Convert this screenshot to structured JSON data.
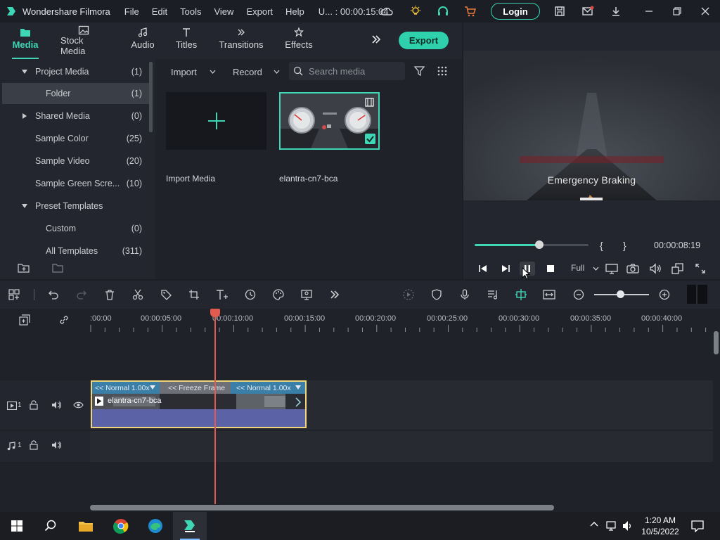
{
  "titlebar": {
    "app_name": "Wondershare Filmora",
    "menu": [
      "File",
      "Edit",
      "Tools",
      "View",
      "Export",
      "Help"
    ],
    "project": "U... : 00:00:15:04",
    "login_label": "Login"
  },
  "tabs": [
    {
      "label": "Media",
      "icon": "folder-icon",
      "active": true
    },
    {
      "label": "Stock Media",
      "icon": "image-icon"
    },
    {
      "label": "Audio",
      "icon": "music-icon"
    },
    {
      "label": "Titles",
      "icon": "text-icon"
    },
    {
      "label": "Transitions",
      "icon": "transition-icon"
    },
    {
      "label": "Effects",
      "icon": "effects-icon"
    }
  ],
  "export_label": "Export",
  "tree": [
    {
      "label": "Project Media",
      "count": "(1)",
      "caret": "down"
    },
    {
      "label": "Folder",
      "count": "(1)",
      "selected": true
    },
    {
      "label": "Shared Media",
      "count": "(0)",
      "caret": "right"
    },
    {
      "label": "Sample Color",
      "count": "(25)"
    },
    {
      "label": "Sample Video",
      "count": "(20)"
    },
    {
      "label": "Sample Green Scre...",
      "count": "(10)"
    },
    {
      "label": "Preset Templates",
      "count": "",
      "caret": "down"
    },
    {
      "label": "Custom",
      "count": "(0)"
    },
    {
      "label": "All Templates",
      "count": "(311)"
    }
  ],
  "media_toolbar": {
    "import_label": "Import",
    "record_label": "Record",
    "search_placeholder": "Search media"
  },
  "media_items": {
    "import_label": "Import Media",
    "clip_label": "elantra-cn7-bca"
  },
  "preview": {
    "caption": "Emergency Braking",
    "progress": 0.57,
    "mark_in": "{",
    "mark_out": "}",
    "timecode": "00:00:08:19",
    "quality": "Full"
  },
  "ruler": {
    "labels": [
      ":00:00",
      "00:00:05:00",
      "00:00:10:00",
      "00:00:15:00",
      "00:00:20:00",
      "00:00:25:00",
      "00:00:30:00",
      "00:00:35:00",
      "00:00:40:00"
    ]
  },
  "tracks": {
    "video_label": "1",
    "audio_label": "1"
  },
  "clip": {
    "segments": [
      {
        "label": "<< Normal 1.00x"
      },
      {
        "label": "<< Freeze Frame"
      },
      {
        "label": "<< Normal 1.00x"
      }
    ],
    "name": "elantra-cn7-bca"
  },
  "taskbar": {
    "time": "1:20 AM",
    "date": "10/5/2022"
  },
  "colors": {
    "accent": "#3ed6b5",
    "playhead": "#e35a4f",
    "clip_border": "#f0d67a",
    "clip_body": "#5b63a6"
  }
}
